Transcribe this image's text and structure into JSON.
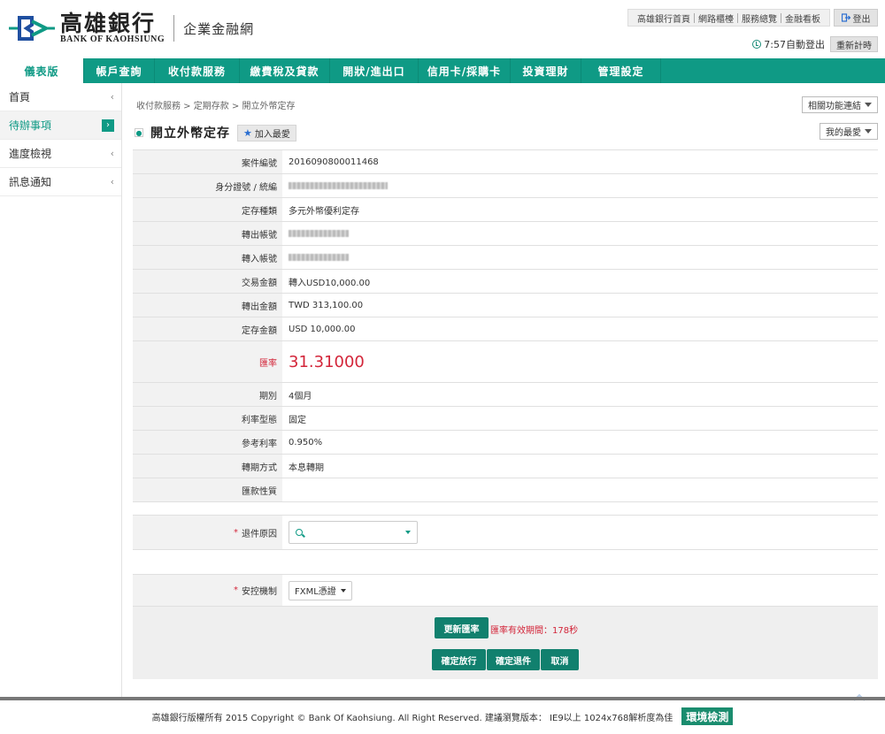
{
  "header": {
    "logo_cn": "高雄銀行",
    "logo_en": "BANK OF KAOHSIUNG",
    "logo_sub": "企業金融網",
    "top_links": [
      "高雄銀行首頁",
      "網路櫃檯",
      "服務總覽",
      "金融看板"
    ],
    "logout_label": "登出",
    "session_text": "7:57自動登出",
    "renew_label": "重新計時"
  },
  "nav": {
    "tabs": [
      "儀表版",
      "帳戶查詢",
      "收付款服務",
      "繳費稅及貸款",
      "開狀/進出口",
      "信用卡/採購卡",
      "投資理財",
      "管理設定"
    ]
  },
  "sidebar": {
    "items": [
      "首頁",
      "待辦事項",
      "進度檢視",
      "訊息通知"
    ]
  },
  "main": {
    "breadcrumb": "收付款服務 > 定期存款 > 開立外幣定存",
    "related_label": "相關功能連結",
    "fav_label": "我的最愛",
    "title": "開立外幣定存",
    "add_fav_label": "加入最愛",
    "rows": [
      {
        "label": "案件編號",
        "value": "2016090800011468"
      },
      {
        "label": "身分證號 / 統編",
        "value": ""
      },
      {
        "label": "定存種類",
        "value": "多元外幣優利定存"
      },
      {
        "label": "轉出帳號",
        "value": ""
      },
      {
        "label": "轉入帳號",
        "value": ""
      },
      {
        "label": "交易金額",
        "value": "轉入USD10,000.00"
      },
      {
        "label": "轉出金額",
        "value": "TWD 313,100.00"
      },
      {
        "label": "定存金額",
        "value": "USD 10,000.00"
      },
      {
        "label": "匯率",
        "value": "31.31000"
      },
      {
        "label": "期別",
        "value": "4個月"
      },
      {
        "label": "利率型態",
        "value": "固定"
      },
      {
        "label": "參考利率",
        "value": "0.950%"
      },
      {
        "label": "轉期方式",
        "value": "本息轉期"
      },
      {
        "label": "匯款性質",
        "value": ""
      }
    ],
    "reject_label": "退件原因",
    "security_label": "安控機制",
    "security_value": "FXML憑證",
    "refresh_rate_label": "更新匯率",
    "validity_text": "匯率有效期間：178秒",
    "confirm_release_label": "確定放行",
    "confirm_reject_label": "確定退件",
    "cancel_label": "取消"
  },
  "footer": {
    "text": "高雄銀行版權所有 2015 Copyright © Bank Of Kaohsiung. All Right Reserved. 建議瀏覽版本： IE9以上 1024x768解析度為佳",
    "env_label": "環境檢測"
  },
  "colors": {
    "brand": "#0f9a85",
    "button": "#11806e",
    "alert": "#d3263a"
  }
}
